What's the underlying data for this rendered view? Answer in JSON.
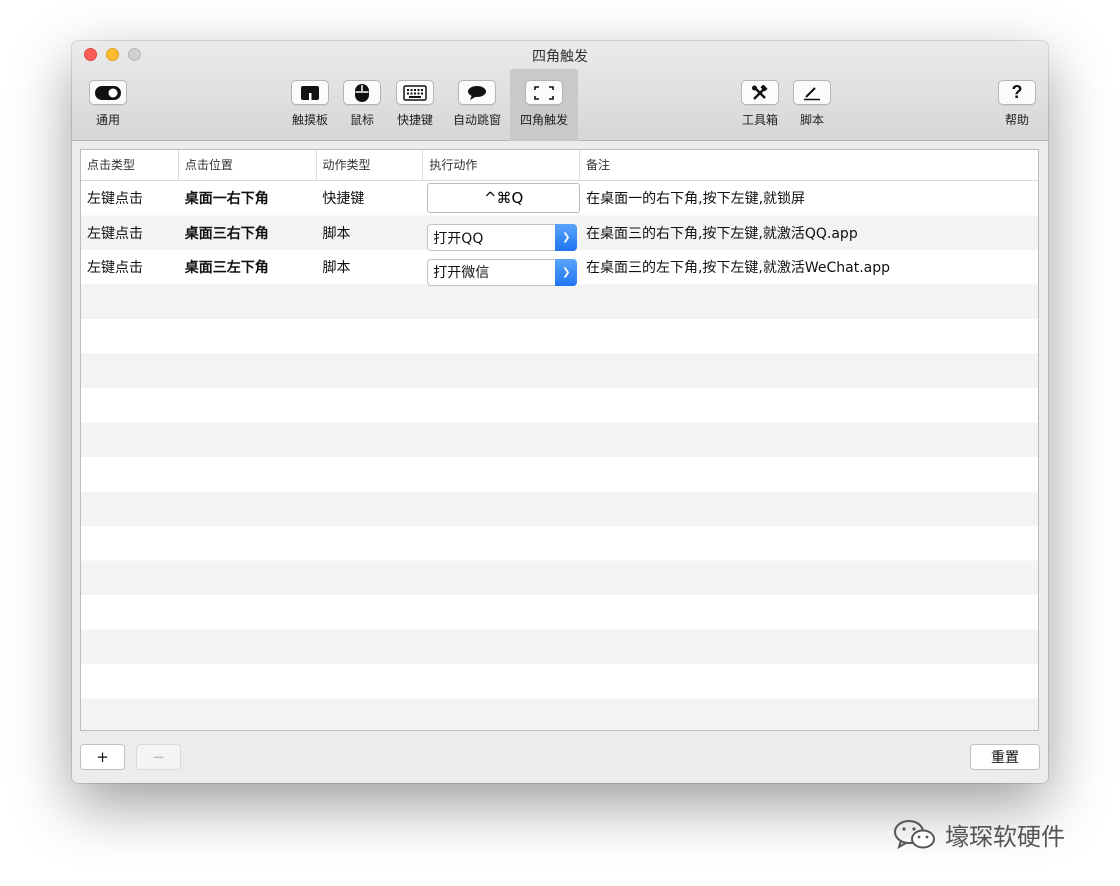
{
  "window": {
    "title": "四角触发"
  },
  "toolbar": {
    "items": [
      {
        "label": "通用",
        "icon": "toggle-icon"
      },
      {
        "label": "触摸板",
        "icon": "trackpad-icon"
      },
      {
        "label": "鼠标",
        "icon": "mouse-icon"
      },
      {
        "label": "快捷键",
        "icon": "keyboard-icon"
      },
      {
        "label": "自动跳窗",
        "icon": "speech-bubble-icon"
      },
      {
        "label": "四角触发",
        "icon": "corners-icon",
        "selected": true
      },
      {
        "label": "工具箱",
        "icon": "tools-icon"
      },
      {
        "label": "脚本",
        "icon": "pen-icon"
      },
      {
        "label": "帮助",
        "icon": "question-icon"
      }
    ]
  },
  "table": {
    "headers": [
      "点击类型",
      "点击位置",
      "动作类型",
      "执行动作",
      "备注"
    ],
    "rows": [
      {
        "click_type": "左键点击",
        "position": "桌面一右下角",
        "action_type": "快捷键",
        "action": "^⌘Q",
        "note": "在桌面一的右下角,按下左键,就锁屏"
      },
      {
        "click_type": "左键点击",
        "position": "桌面三右下角",
        "action_type": "脚本",
        "action": "打开QQ",
        "note": "在桌面三的右下角,按下左键,就激活QQ.app"
      },
      {
        "click_type": "左键点击",
        "position": "桌面三左下角",
        "action_type": "脚本",
        "action": "打开微信",
        "note": "在桌面三的左下角,按下左键,就激活WeChat.app"
      }
    ]
  },
  "bottom": {
    "add_label": "+",
    "remove_label": "−",
    "reset_label": "重置"
  },
  "watermark": {
    "text": "壕琛软硬件"
  },
  "colors": {
    "selected_toolbar": "#c9c9c9",
    "popup_accent": "#1f74f2",
    "close": "#fc5f57",
    "minimize": "#fdbc2f"
  }
}
